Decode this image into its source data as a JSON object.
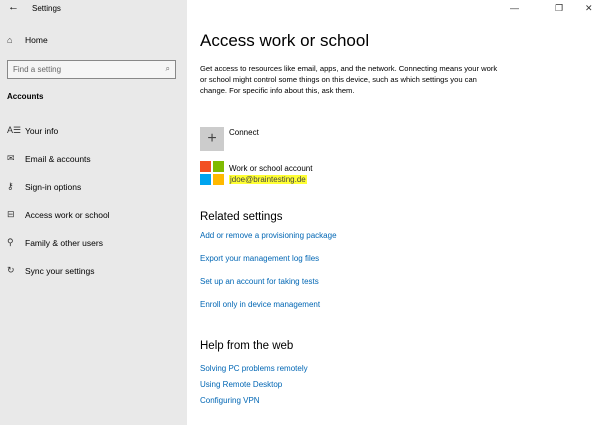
{
  "window": {
    "title": "Settings",
    "minimize": "—",
    "restore": "❐",
    "close": "✕"
  },
  "sidebar": {
    "home": "Home",
    "search_placeholder": "Find a setting",
    "section": "Accounts",
    "items": [
      {
        "label": "Your info",
        "icon": "person-lines-icon",
        "glyph": "A☰"
      },
      {
        "label": "Email & accounts",
        "icon": "envelope-icon",
        "glyph": "✉"
      },
      {
        "label": "Sign-in options",
        "icon": "key-icon",
        "glyph": "⚷"
      },
      {
        "label": "Access work or school",
        "icon": "briefcase-icon",
        "glyph": "⊟"
      },
      {
        "label": "Family & other users",
        "icon": "person-add-icon",
        "glyph": "⚲"
      },
      {
        "label": "Sync your settings",
        "icon": "sync-icon",
        "glyph": "↻"
      }
    ]
  },
  "main": {
    "title": "Access work or school",
    "description": "Get access to resources like email, apps, and the network. Connecting means your work or school might control some things on this device, such as which settings you can change. For specific info about this, ask them.",
    "connect": "Connect",
    "account_type": "Work or school account",
    "account_email": "jdoe@braintesting.de",
    "related_heading": "Related settings",
    "related_links": [
      "Add or remove a provisioning package",
      "Export your management log files",
      "Set up an account for taking tests",
      "Enroll only in device management"
    ],
    "web_heading": "Help from the web",
    "web_links": [
      "Solving PC problems remotely",
      "Using Remote Desktop",
      "Configuring VPN"
    ]
  },
  "colors": {
    "ms_red": "#f25022",
    "ms_green": "#7fba00",
    "ms_blue": "#00a4ef",
    "ms_yellow": "#ffb900",
    "link": "#0066b4"
  }
}
